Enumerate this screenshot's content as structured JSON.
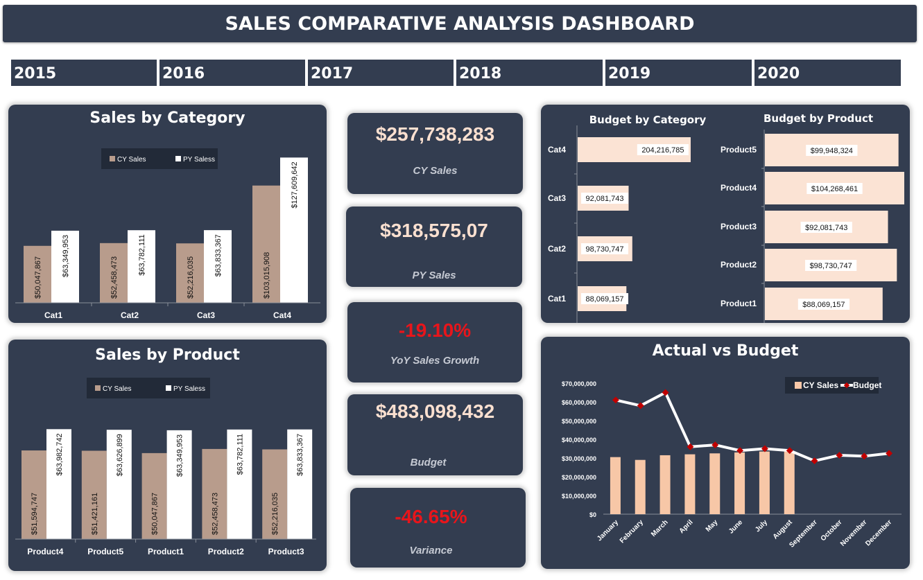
{
  "dashboard": {
    "title": "SALES COMPARATIVE ANALYSIS DASHBOARD"
  },
  "years": [
    "2015",
    "2016",
    "2017",
    "2018",
    "2019",
    "2020"
  ],
  "colors": {
    "panel": "#333d50",
    "cy_bar": "#b89c8c",
    "py_bar": "#ffffff",
    "budget_bar": "#fbe3d4",
    "actual_bar": "#f7c7a7",
    "budget_line": "#ffffff",
    "budget_marker": "#c00000",
    "kpi_value": "#fbe0d0",
    "kpi_negative": "#e8151b"
  },
  "kpis": [
    {
      "value": "$257,738,283",
      "label": "CY Sales",
      "negative": false
    },
    {
      "value": "$318,575,07",
      "label": "PY Sales",
      "negative": false
    },
    {
      "value": "-19.10%",
      "label": "YoY Sales Growth",
      "negative": true
    },
    {
      "value": "$483,098,432",
      "label": "Budget",
      "negative": false
    },
    {
      "value": "-46.65%",
      "label": "Variance",
      "negative": true
    }
  ],
  "chart_data": [
    {
      "id": "sales_by_category",
      "type": "bar",
      "title": "Sales by Category",
      "categories": [
        "Cat1",
        "Cat2",
        "Cat3",
        "Cat4"
      ],
      "series": [
        {
          "name": "CY Sales",
          "values": [
            50047867,
            52458473,
            52216035,
            103015908
          ],
          "labels": [
            "$50,047,867",
            "$52,458,473",
            "$52,216,035",
            "$103,015,908"
          ]
        },
        {
          "name": "PY Saless",
          "values": [
            63349953,
            63782111,
            63833367,
            127609642
          ],
          "labels": [
            "$63,349,953",
            "$63,782,111",
            "$63,833,367",
            "$127,609,642"
          ]
        }
      ],
      "ylim": [
        0,
        140000000
      ],
      "legend": "top-center",
      "grid": false
    },
    {
      "id": "sales_by_product",
      "type": "bar",
      "title": "Sales by Product",
      "categories": [
        "Product4",
        "Product5",
        "Product1",
        "Product2",
        "Product3"
      ],
      "series": [
        {
          "name": "CY Sales",
          "values": [
            51594747,
            51421161,
            50047867,
            52458473,
            52216035
          ],
          "labels": [
            "$51,594,747",
            "$51,421,161",
            "$50,047,867",
            "$52,458,473",
            "$52,216,035"
          ]
        },
        {
          "name": "PY Saless",
          "values": [
            63982742,
            63626899,
            63349953,
            63782111,
            63833367
          ],
          "labels": [
            "$63,982,742",
            "$63,626,899",
            "$63,349,953",
            "$63,782,111",
            "$63,833,367"
          ]
        }
      ],
      "ylim": [
        0,
        75000000
      ],
      "legend": "top-center",
      "grid": false
    },
    {
      "id": "budget_by_category",
      "type": "bar",
      "orientation": "horizontal",
      "title": "Budget by Category",
      "categories": [
        "Cat4",
        "Cat3",
        "Cat2",
        "Cat1"
      ],
      "values": [
        204216785,
        92081743,
        98730747,
        88069157
      ],
      "labels": [
        "204,216,785",
        "92,081,743",
        "98,730,747",
        "88,069,157"
      ],
      "xlim": [
        0,
        204216785
      ]
    },
    {
      "id": "budget_by_product",
      "type": "bar",
      "orientation": "horizontal",
      "title": "Budget by Product",
      "categories": [
        "Product5",
        "Product4",
        "Product3",
        "Product2",
        "Product1"
      ],
      "values": [
        99948324,
        104268461,
        92081743,
        98730747,
        88069157
      ],
      "labels": [
        "$99,948,324",
        "$104,268,461",
        "$92,081,743",
        "$98,730,747",
        "$88,069,157"
      ],
      "xlim": [
        0,
        104268461
      ]
    },
    {
      "id": "actual_vs_budget",
      "type": "bar",
      "title": "Actual vs Budget",
      "categories": [
        "January",
        "February",
        "March",
        "April",
        "May",
        "June",
        "July",
        "August",
        "September",
        "October",
        "November",
        "December"
      ],
      "series": [
        {
          "name": "CY Sales",
          "type": "bar",
          "values": [
            30500000,
            29000000,
            31500000,
            32000000,
            32500000,
            33000000,
            33500000,
            33500000,
            null,
            null,
            null,
            null
          ]
        },
        {
          "name": "Budget",
          "type": "line",
          "values": [
            61000000,
            58000000,
            65000000,
            36000000,
            37000000,
            34000000,
            35000000,
            34000000,
            28500000,
            31500000,
            31000000,
            32500000
          ]
        }
      ],
      "yticks": [
        "$0",
        "$10,000,000",
        "$20,000,000",
        "$30,000,000",
        "$40,000,000",
        "$50,000,000",
        "$60,000,000",
        "$70,000,000"
      ],
      "ylim": [
        0,
        70000000
      ],
      "legend": "top-right",
      "grid": false
    }
  ]
}
